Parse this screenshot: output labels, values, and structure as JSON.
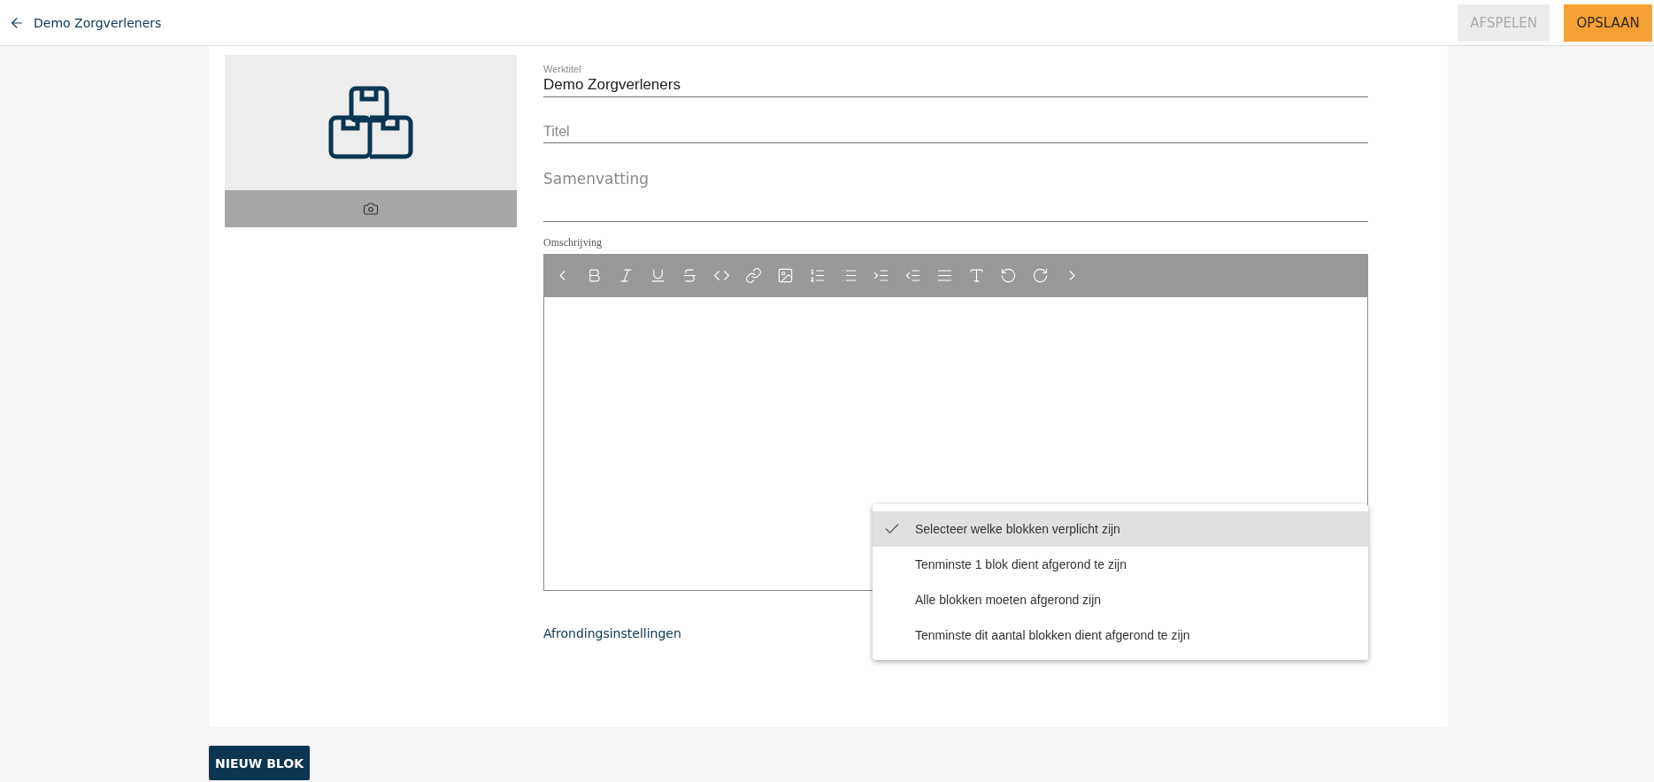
{
  "header": {
    "title": "Demo Zorgverleners",
    "buttons": [
      {
        "label": "AFSPELEN",
        "disabled": true
      },
      {
        "label": "OPSLAAN",
        "disabled": false
      }
    ]
  },
  "form": {
    "werktitel": {
      "label": "Werktitel",
      "value": "Demo Zorgverleners"
    },
    "titel": {
      "placeholder": "Titel"
    },
    "samenvatting": {
      "placeholder": "Samenvatting"
    },
    "omschrijving": {
      "label": "Omschrijving"
    },
    "completion_label": "Afrondingsinstellingen",
    "completion_options": [
      {
        "label": "Selecteer welke blokken verplicht zijn",
        "selected": true
      },
      {
        "label": "Tenminste 1 blok dient afgerond te zijn",
        "selected": false
      },
      {
        "label": "Alle blokken moeten afgerond zijn",
        "selected": false
      },
      {
        "label": "Tenminste dit aantal blokken dient afgerond te zijn",
        "selected": false
      }
    ]
  },
  "new_block_button": "NIEUW BLOK"
}
